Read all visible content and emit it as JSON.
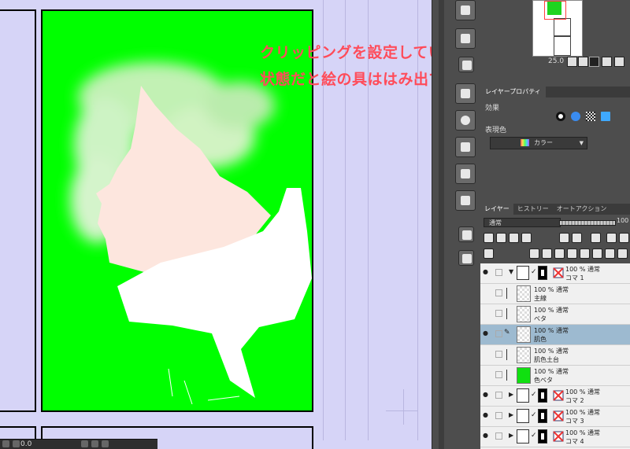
{
  "annotation": {
    "line1": "クリッピングを設定していない",
    "line2": "状態だと絵の具ははみ出ている"
  },
  "colors": {
    "annotation": "#ff4c5a",
    "canvas_bg": "#d6d4f7",
    "fill_green": "#00ff00",
    "skin": "#fde6de",
    "selected_row": "#9dbad0"
  },
  "navigator": {
    "zoom": "25.0"
  },
  "property_panel": {
    "tab_label": "レイヤープロパティ",
    "effect_label": "効果",
    "expression_color_label": "表現色",
    "expression_color_value": "カラー"
  },
  "layer_panel": {
    "tabs": [
      "レイヤー",
      "ヒストリー",
      "オートアクション"
    ],
    "blend_mode": "通常",
    "opacity": "100",
    "layers": [
      {
        "type": "folder",
        "line1": "100 % 通常",
        "line2": "コマ 1",
        "visible": true,
        "expanded": true
      },
      {
        "type": "layer",
        "line1": "100 % 通常",
        "line2": "主線",
        "visible": false
      },
      {
        "type": "layer",
        "line1": "100 % 通常",
        "line2": "ベタ",
        "visible": false
      },
      {
        "type": "layer",
        "line1": "100 % 通常",
        "line2": "肌色",
        "visible": true,
        "selected": true
      },
      {
        "type": "layer",
        "line1": "100 % 通常",
        "line2": "肌色土台",
        "visible": false
      },
      {
        "type": "layer",
        "line1": "100 % 通常",
        "line2": "色ベタ",
        "visible": false,
        "thumb": "green"
      },
      {
        "type": "folder",
        "line1": "100 % 通常",
        "line2": "コマ 2",
        "visible": true,
        "expanded": false
      },
      {
        "type": "folder",
        "line1": "100 % 通常",
        "line2": "コマ 3",
        "visible": true,
        "expanded": false
      },
      {
        "type": "folder",
        "line1": "100 % 通常",
        "line2": "コマ 4",
        "visible": true,
        "expanded": false
      }
    ]
  },
  "status_bar": {
    "zoom_value": "0.0"
  }
}
